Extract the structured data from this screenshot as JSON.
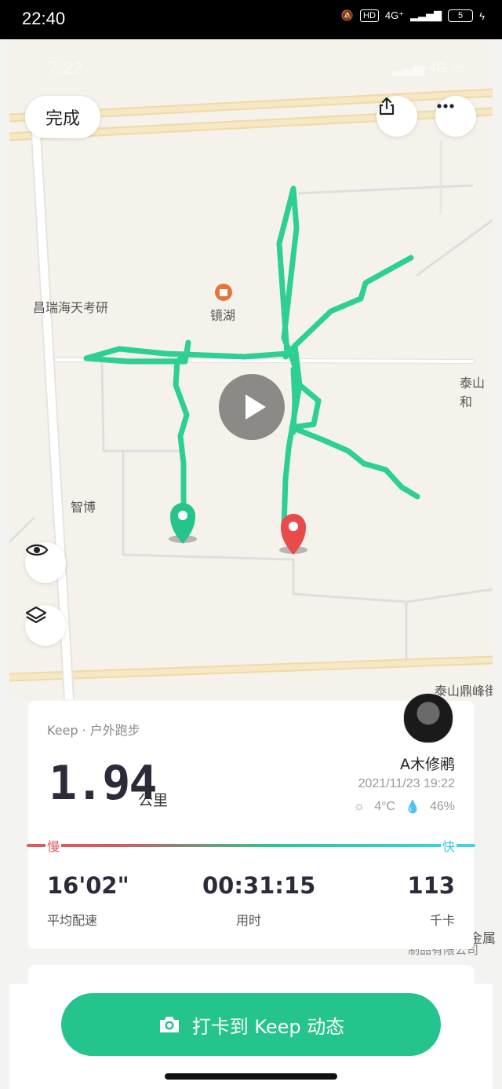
{
  "status_bar": {
    "time": "22:40",
    "network": "4G⁺",
    "hd": "HD",
    "battery": "5"
  },
  "map": {
    "ghost_time": "7:22",
    "ghost_network": "4G",
    "labels": {
      "chang_rui": "昌瑞海天考研",
      "jing_hu": "镜湖",
      "tai_shan_right": "泰山和",
      "zhi_bo": "智博",
      "tai_shan_bottom": "泰山鼎峰街",
      "metal": "金属",
      "metal_company": "制品有限公司"
    },
    "done_label": "完成",
    "icons": [
      "share-icon",
      "more-icon",
      "eye-icon",
      "layers-icon",
      "play-icon"
    ],
    "route_color": "#2ecf94",
    "start_color": "#24c48c",
    "end_color": "#e84b4b"
  },
  "summary": {
    "source": "Keep · 户外跑步",
    "distance": "1.94",
    "distance_unit": "公里",
    "user_name": "A木修鹇",
    "datetime": "2021/11/23 19:22",
    "temperature": "4°C",
    "humidity": "46%",
    "slow_label": "慢",
    "fast_label": "快",
    "stats": [
      {
        "value": "16'02\"",
        "label": "平均配速"
      },
      {
        "value": "00:31:15",
        "label": "用时"
      },
      {
        "value": "113",
        "label": "千卡"
      }
    ]
  },
  "cta": {
    "label": "打卡到 Keep 动态",
    "icon": "camera-icon"
  }
}
